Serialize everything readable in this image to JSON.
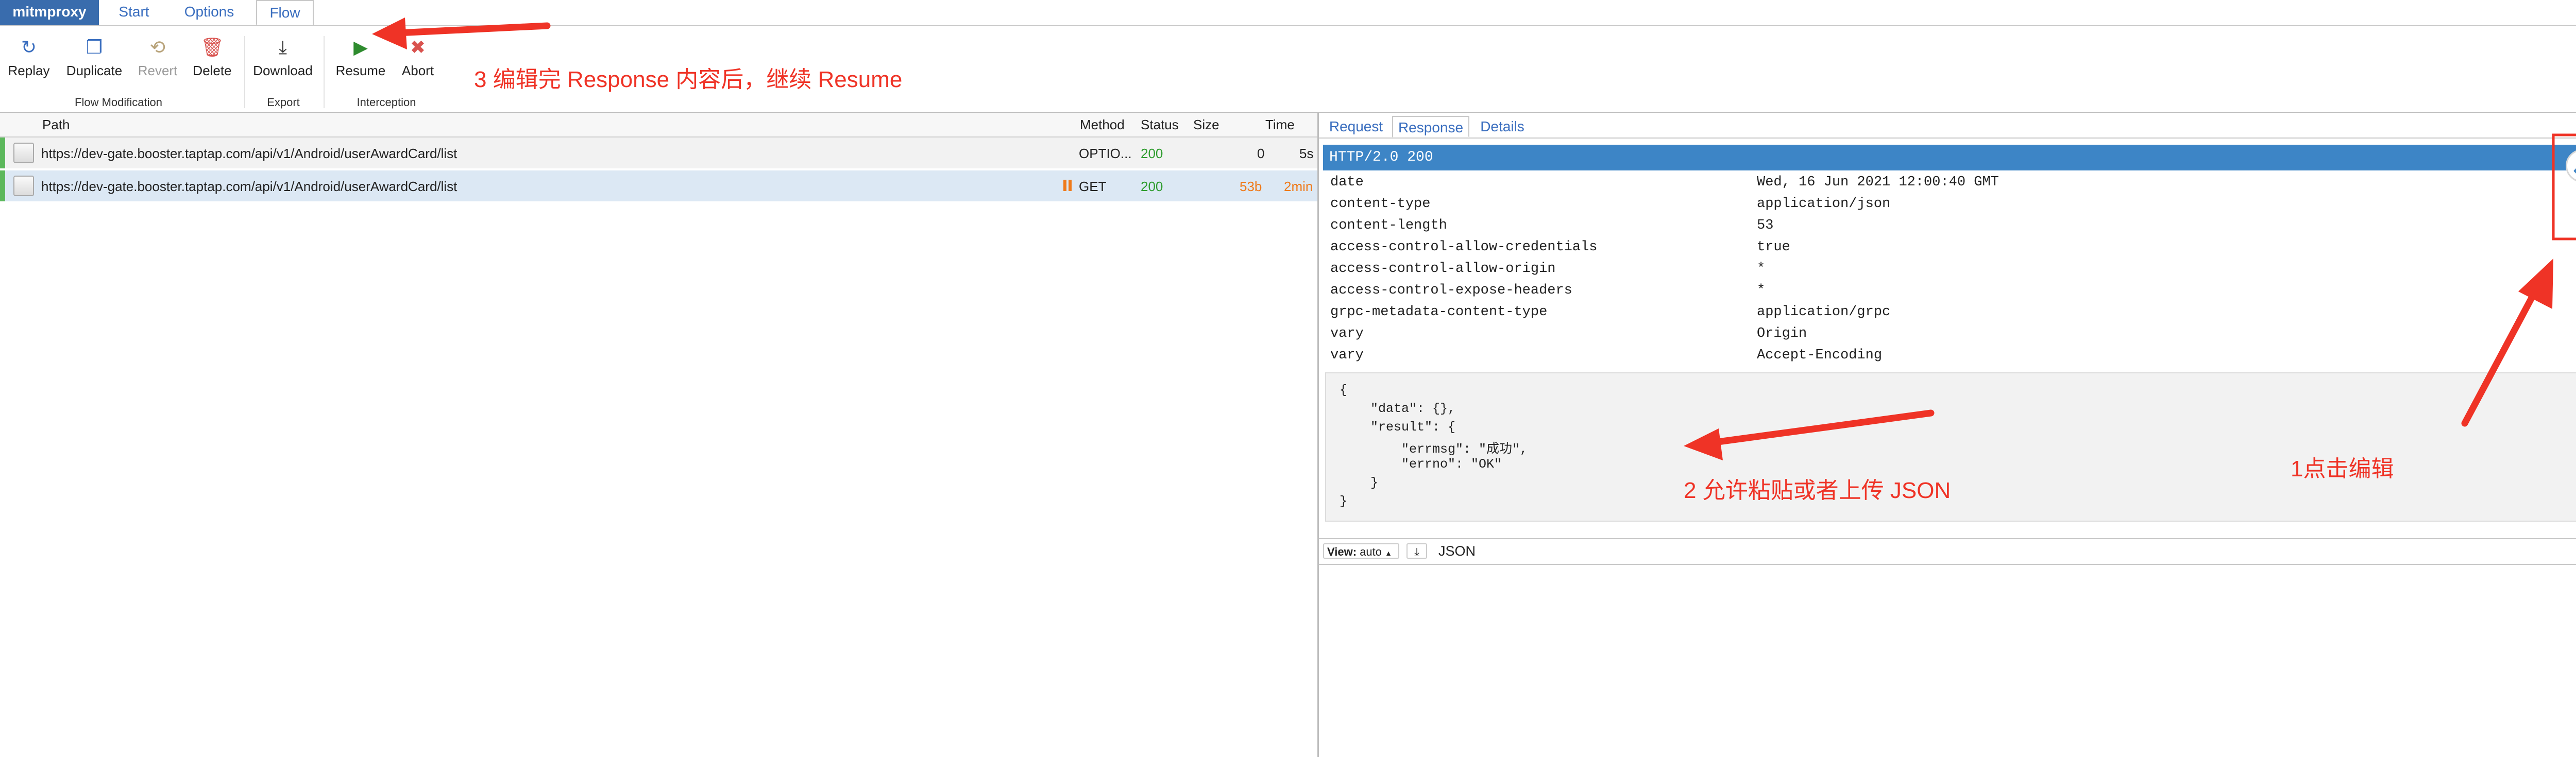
{
  "nav": {
    "brand": "mitmproxy",
    "tabs": [
      {
        "label": "Start"
      },
      {
        "label": "Options"
      },
      {
        "label": "Flow"
      }
    ],
    "active_tab": "Flow"
  },
  "toolbar": {
    "replay": "Replay",
    "duplicate": "Duplicate",
    "revert": "Revert",
    "delete": "Delete",
    "download": "Download",
    "resume": "Resume",
    "abort": "Abort",
    "group_flow_modification": "Flow Modification",
    "group_export": "Export",
    "group_interception": "Interception"
  },
  "annotations": {
    "step3": "3 编辑完 Response 内容后，继续 Resume",
    "step2": "2 允许粘贴或者上传 JSON",
    "step1": "1点击编辑",
    "color": "#ef3326"
  },
  "flow_list": {
    "columns": {
      "path": "Path",
      "method": "Method",
      "status": "Status",
      "size": "Size",
      "time": "Time"
    },
    "rows": [
      {
        "path": "https://dev-gate.booster.taptap.com/api/v1/Android/userAwardCard/list",
        "method": "OPTIO...",
        "status": "200",
        "size": "0",
        "time": "5s"
      },
      {
        "path": "https://dev-gate.booster.taptap.com/api/v1/Android/userAwardCard/list",
        "method": "GET",
        "status": "200",
        "size": "53b",
        "time": "2min"
      }
    ]
  },
  "detail": {
    "tabs": [
      {
        "label": "Request"
      },
      {
        "label": "Response"
      },
      {
        "label": "Details"
      }
    ],
    "active_tab": "Response",
    "status_line": "HTTP/2.0 200",
    "headers": [
      {
        "name": "date",
        "value": "Wed, 16 Jun 2021 12:00:40 GMT"
      },
      {
        "name": "content-type",
        "value": "application/json"
      },
      {
        "name": "content-length",
        "value": "53"
      },
      {
        "name": "access-control-allow-credentials",
        "value": "true"
      },
      {
        "name": "access-control-allow-origin",
        "value": "*"
      },
      {
        "name": "access-control-expose-headers",
        "value": "*"
      },
      {
        "name": "grpc-metadata-content-type",
        "value": "application/grpc"
      },
      {
        "name": "vary",
        "value": "Origin"
      },
      {
        "name": "vary",
        "value": "Accept-Encoding"
      }
    ],
    "body_lines": [
      "{",
      "    \"data\": {},",
      "    \"result\": {",
      "        \"errmsg\": \"成功\",",
      "        \"errno\": \"OK\"",
      "    }",
      "}"
    ],
    "view": {
      "label": "View:",
      "mode": "auto",
      "content_type": "JSON"
    }
  },
  "colors": {
    "brand": "#396cad",
    "accent": "#3a6ebf",
    "status_ok": "#2e9c2e",
    "orange": "#ef7a1a",
    "http_bar": "#3d85c6"
  }
}
